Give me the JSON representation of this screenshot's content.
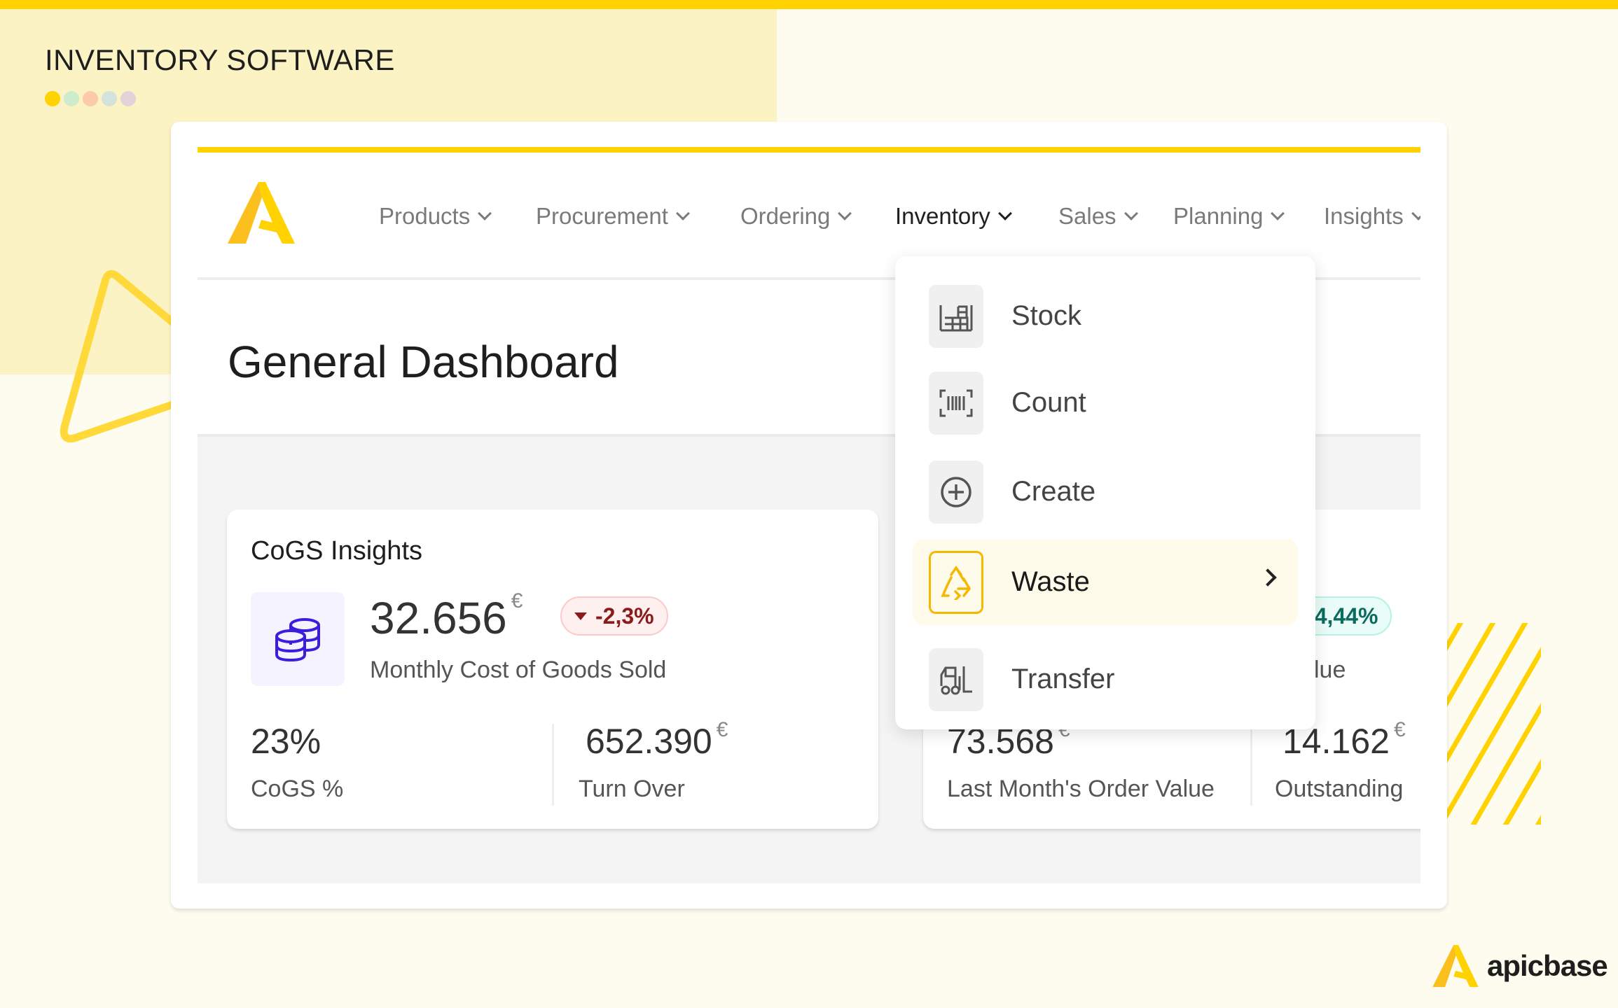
{
  "banner": {
    "title": "INVENTORY SOFTWARE",
    "dot_colors": [
      "#ffd200",
      "#cdeccd",
      "#fbcaa8",
      "#d3e2da",
      "#e2d3d8"
    ]
  },
  "colors": {
    "accent": "#ffd200",
    "negative": "#8b1a1a",
    "positive": "#0b6b5e",
    "coins_icon": "#3a1ee0"
  },
  "nav": {
    "items": [
      {
        "label": "Products"
      },
      {
        "label": "Procurement"
      },
      {
        "label": "Ordering"
      },
      {
        "label": "Inventory",
        "active": true
      },
      {
        "label": "Sales"
      },
      {
        "label": "Planning"
      },
      {
        "label": "Insights"
      }
    ]
  },
  "page": {
    "title": "General Dashboard"
  },
  "cogs": {
    "title": "CoGS Insights",
    "value": "32.656",
    "currency": "€",
    "change": "-2,3%",
    "change_direction": "down",
    "label": "Monthly Cost of Goods Sold",
    "stats": [
      {
        "value": "23%",
        "label": "CoGS %"
      },
      {
        "value": "652.390",
        "currency": "€",
        "label": "Turn Over"
      }
    ]
  },
  "orders": {
    "change": "+4,44%",
    "label_partial": "lue",
    "stats": [
      {
        "value": "73.568",
        "currency": "€",
        "label": "Last Month's Order Value"
      },
      {
        "value": "14.162",
        "currency": "€",
        "label": "Outstanding"
      }
    ]
  },
  "inventory_menu": {
    "items": [
      {
        "label": "Stock",
        "icon": "warehouse-icon"
      },
      {
        "label": "Count",
        "icon": "barcode-scan-icon"
      },
      {
        "label": "Create",
        "icon": "plus-circle-icon"
      },
      {
        "label": "Waste",
        "icon": "recycle-icon",
        "highlighted": true,
        "has_submenu": true
      },
      {
        "label": "Transfer",
        "icon": "forklift-icon"
      }
    ]
  },
  "footer": {
    "logo_text": "apicbase"
  }
}
